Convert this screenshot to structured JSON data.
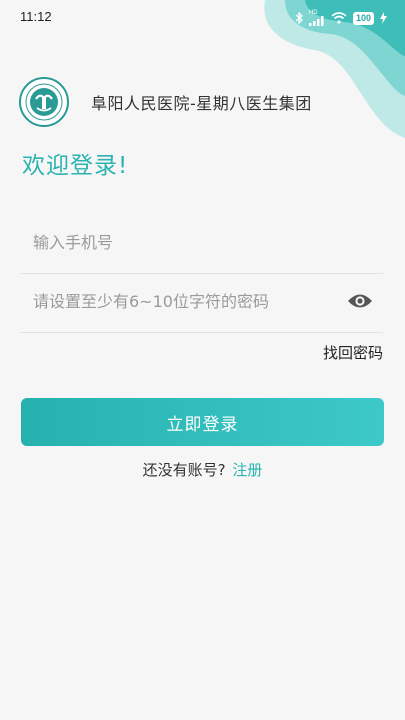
{
  "status_bar": {
    "time": "11:12",
    "network_badge": "HD",
    "battery": "100"
  },
  "header": {
    "hospital_name": "阜阳人民医院-星期八医生集团"
  },
  "welcome_text": "欢迎登录!",
  "form": {
    "phone_placeholder": "输入手机号",
    "password_placeholder": "请设置至少有6~10位字符的密码",
    "forgot_password": "找回密码",
    "login_button": "立即登录"
  },
  "register": {
    "prompt": "还没有账号?",
    "link": "注册"
  },
  "colors": {
    "accent": "#2ab3b1",
    "accent_light": "#3ec9c9",
    "background": "#f6f6f6"
  },
  "icons": [
    "bluetooth-icon",
    "signal-icon",
    "wifi-icon",
    "battery-icon",
    "charging-icon",
    "eye-icon",
    "hospital-logo"
  ]
}
